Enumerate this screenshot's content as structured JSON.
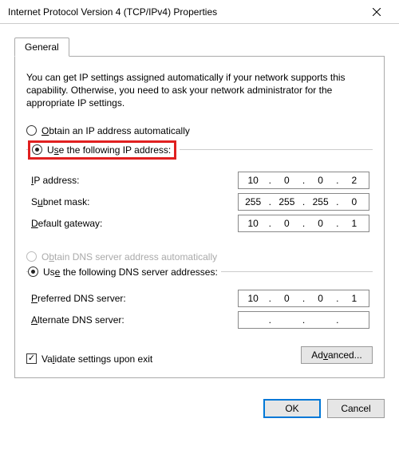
{
  "window": {
    "title": "Internet Protocol Version 4 (TCP/IPv4) Properties"
  },
  "tab": {
    "label": "General"
  },
  "intro": "You can get IP settings assigned automatically if your network supports this capability. Otherwise, you need to ask your network administrator for the appropriate IP settings.",
  "ip": {
    "auto_label": "Obtain an IP address automatically",
    "manual_label": "Use the following IP address:",
    "address_label": "IP address:",
    "subnet_label": "Subnet mask:",
    "gateway_label": "Default gateway:",
    "address": [
      "10",
      "0",
      "0",
      "2"
    ],
    "subnet": [
      "255",
      "255",
      "255",
      "0"
    ],
    "gateway": [
      "10",
      "0",
      "0",
      "1"
    ]
  },
  "dns": {
    "auto_label": "Obtain DNS server address automatically",
    "manual_label": "Use the following DNS server addresses:",
    "pref_label": "Preferred DNS server:",
    "alt_label": "Alternate DNS server:",
    "pref": [
      "10",
      "0",
      "0",
      "1"
    ],
    "alt": [
      "",
      "",
      "",
      ""
    ]
  },
  "validate_label": "Validate settings upon exit",
  "advanced_label": "Advanced...",
  "buttons": {
    "ok": "OK",
    "cancel": "Cancel"
  }
}
